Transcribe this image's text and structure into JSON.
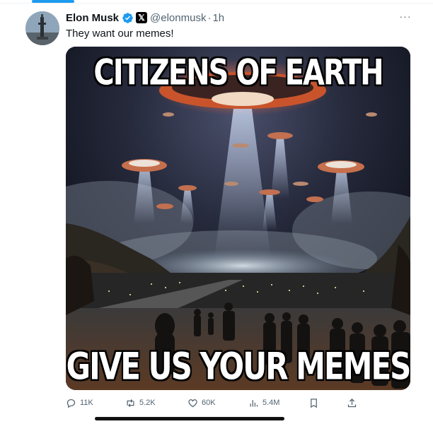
{
  "header": {
    "display_name": "Elon Musk",
    "affiliate_badge": "𝕏",
    "handle": "@elonmusk",
    "separator": "·",
    "time": "1h",
    "more": "···"
  },
  "tweet": {
    "text": "They want our memes!",
    "media": {
      "top_caption": "CITIZENS OF EARTH",
      "bottom_caption": "GIVE US YOUR MEMES"
    }
  },
  "actions": {
    "replies": "11K",
    "reposts": "5.2K",
    "likes": "60K",
    "views": "5.4M"
  },
  "icons": {
    "verified": "verified-badge-icon",
    "reply": "reply-icon",
    "repost": "repost-icon",
    "like": "heart-icon",
    "views": "views-icon",
    "bookmark": "bookmark-icon",
    "share": "share-icon"
  },
  "colors": {
    "accent": "#1d9bf0",
    "secondary_text": "#536471",
    "primary_text": "#0f1419"
  }
}
